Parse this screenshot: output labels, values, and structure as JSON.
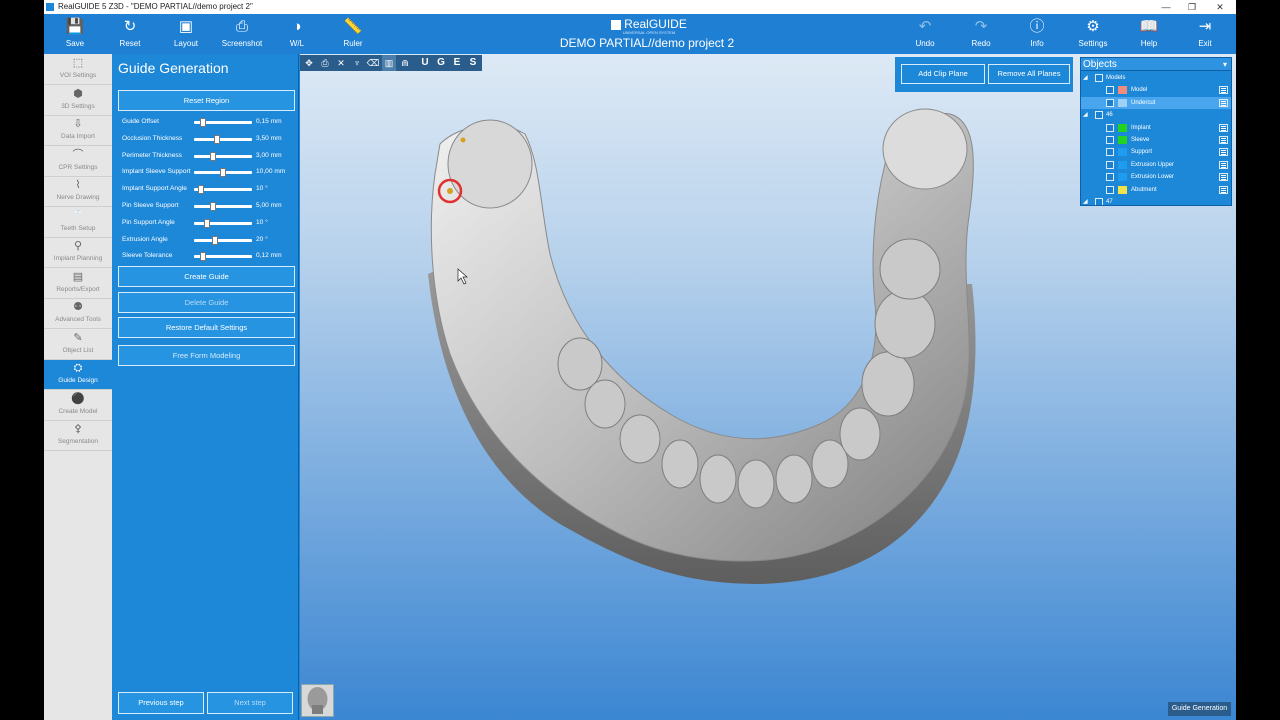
{
  "window": {
    "title": "RealGUIDE 5 Z3D - \"DEMO PARTIAL//demo project 2\"",
    "minimize_glyph": "—",
    "restore_glyph": "❐",
    "close_glyph": "✕"
  },
  "toolbar": {
    "save": {
      "label": "Save",
      "icon": "💾"
    },
    "reset": {
      "label": "Reset",
      "icon": "↻"
    },
    "layout": {
      "label": "Layout",
      "icon": "▣"
    },
    "screenshot": {
      "label": "Screenshot",
      "icon": "⎙"
    },
    "wl": {
      "label": "W/L",
      "icon": "◑"
    },
    "ruler": {
      "label": "Ruler",
      "icon": "📏"
    },
    "undo": {
      "label": "Undo",
      "icon": "↶"
    },
    "redo": {
      "label": "Redo",
      "icon": "↷"
    },
    "info": {
      "label": "Info",
      "icon": "ⓘ"
    },
    "settings": {
      "label": "Settings",
      "icon": "⚙"
    },
    "help": {
      "label": "Help",
      "icon": "📖"
    },
    "exit": {
      "label": "Exit",
      "icon": "⇥"
    }
  },
  "brand": {
    "name": "RealGUIDE",
    "tagline": "UNIVERSAL OPEN SYSTEM"
  },
  "project_title": "DEMO PARTIAL//demo project 2",
  "left_nav": {
    "items": [
      {
        "label": "VOI Settings",
        "icon": "⬚"
      },
      {
        "label": "3D Settings",
        "icon": "⬢"
      },
      {
        "label": "Data Import",
        "icon": "⇩"
      },
      {
        "label": "CPR Settings",
        "icon": "⌒"
      },
      {
        "label": "Nerve Drawing",
        "icon": "⌇"
      },
      {
        "label": "Teeth Setup",
        "icon": "🦷"
      },
      {
        "label": "Implant Planning",
        "icon": "⚲"
      },
      {
        "label": "Reports/Export",
        "icon": "▤"
      },
      {
        "label": "Advanced Tools",
        "icon": "⚉"
      },
      {
        "label": "Object List",
        "icon": "✎"
      },
      {
        "label": "Guide Design",
        "icon": "⛭"
      },
      {
        "label": "Create Model",
        "icon": "⚫"
      },
      {
        "label": "Segmentation",
        "icon": "⚴"
      }
    ],
    "active_index": 10
  },
  "panel": {
    "title": "Guide Generation",
    "reset_region": "Reset Region",
    "params": [
      {
        "label": "Guide Offset",
        "value": "0,15 mm",
        "level": 0.12
      },
      {
        "label": "Occlusion Thickness",
        "value": "3,50 mm",
        "level": 0.38
      },
      {
        "label": "Perimeter Thickness",
        "value": "3,00 mm",
        "level": 0.3
      },
      {
        "label": "Implant Sleeve Support",
        "value": "10,00 mm",
        "level": 0.5
      },
      {
        "label": "Implant Support Angle",
        "value": "10 °",
        "level": 0.08
      },
      {
        "label": "Pin Sleeve Support",
        "value": "5,00   mm",
        "level": 0.3
      },
      {
        "label": "Pin Support Angle",
        "value": "10 °",
        "level": 0.2
      },
      {
        "label": "Extrusion Angle",
        "value": "20 °",
        "level": 0.35
      },
      {
        "label": "Sleeve Tolerance",
        "value": "0,12 mm",
        "level": 0.12
      }
    ],
    "create_guide": "Create Guide",
    "delete_guide": "Delete Guide",
    "restore_defaults": "Restore Default Settings",
    "free_form": "Free Form Modeling",
    "previous_step": "Previous step",
    "next_step": "Next step"
  },
  "viewport": {
    "tools": [
      {
        "glyph": "✥",
        "name": "move-tool-icon"
      },
      {
        "glyph": "⎙",
        "name": "camera-icon"
      },
      {
        "glyph": "✕",
        "name": "close-icon"
      },
      {
        "glyph": "♆",
        "name": "implant-icon"
      },
      {
        "glyph": "⌫",
        "name": "eraser-icon"
      },
      {
        "glyph": "▥",
        "name": "comb-icon"
      },
      {
        "glyph": "⋒",
        "name": "arch-icon"
      },
      {
        "glyph": "U",
        "name": "view-u-button"
      },
      {
        "glyph": "G",
        "name": "view-g-button"
      },
      {
        "glyph": "E",
        "name": "view-e-button"
      },
      {
        "glyph": "S",
        "name": "view-s-button"
      }
    ],
    "add_clip_plane": "Add Clip Plane",
    "remove_all_planes": "Remove All Planes",
    "footer_label": "Guide Generation",
    "mesh_color": "#a9a9a9"
  },
  "objects": {
    "title": "Objects",
    "dropdown_glyph": "▾",
    "rows": [
      {
        "indent": 0,
        "tw": "◢",
        "label": "Models",
        "has_cb": true,
        "color": null,
        "menu": false,
        "sel": false
      },
      {
        "indent": 1,
        "tw": "",
        "label": "Model",
        "has_cb": true,
        "color": "#f08c7c",
        "menu": true,
        "sel": false
      },
      {
        "indent": 1,
        "tw": "",
        "label": "Undercut",
        "has_cb": true,
        "color": "#9fd0f5",
        "menu": true,
        "sel": true
      },
      {
        "indent": 0,
        "tw": "◢",
        "label": "46",
        "has_cb": true,
        "color": null,
        "menu": false,
        "sel": false
      },
      {
        "indent": 1,
        "tw": "",
        "label": "Implant",
        "has_cb": true,
        "color": "#22d322",
        "menu": true,
        "sel": false
      },
      {
        "indent": 1,
        "tw": "",
        "label": "Sleeve",
        "has_cb": true,
        "color": "#22d322",
        "menu": true,
        "sel": false
      },
      {
        "indent": 1,
        "tw": "",
        "label": "Support",
        "has_cb": true,
        "color": "#1f9cf0",
        "menu": true,
        "sel": false
      },
      {
        "indent": 1,
        "tw": "",
        "label": "Extrusion Upper",
        "has_cb": true,
        "color": "#1f9cf0",
        "menu": true,
        "sel": false
      },
      {
        "indent": 1,
        "tw": "",
        "label": "Extrusion Lower",
        "has_cb": true,
        "color": "#1f9cf0",
        "menu": true,
        "sel": false
      },
      {
        "indent": 1,
        "tw": "",
        "label": "Abutment",
        "has_cb": true,
        "color": "#f2e34a",
        "menu": true,
        "sel": false
      },
      {
        "indent": 0,
        "tw": "◢",
        "label": "47",
        "has_cb": true,
        "color": null,
        "menu": false,
        "sel": false
      }
    ]
  }
}
